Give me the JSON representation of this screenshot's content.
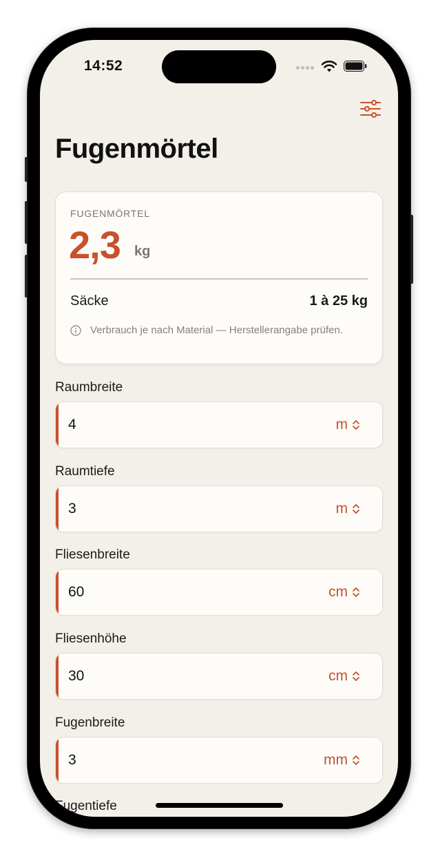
{
  "status_bar": {
    "time": "14:52"
  },
  "page": {
    "title": "Fugenmörtel"
  },
  "result": {
    "label": "FUGENMÖRTEL",
    "value": "2,3",
    "unit": "kg",
    "bags_label": "Säcke",
    "bags_value": "1 à 25 kg",
    "note": "Verbrauch je nach Material — Herstellerangabe prüfen."
  },
  "fields": [
    {
      "label": "Raumbreite",
      "value": "4",
      "unit": "m"
    },
    {
      "label": "Raumtiefe",
      "value": "3",
      "unit": "m"
    },
    {
      "label": "Fliesenbreite",
      "value": "60",
      "unit": "cm"
    },
    {
      "label": "Fliesenhöhe",
      "value": "30",
      "unit": "cm"
    },
    {
      "label": "Fugenbreite",
      "value": "3",
      "unit": "mm"
    },
    {
      "label": "Fugentiefe"
    }
  ],
  "icons": {
    "filter": "sliders-icon",
    "info": "info-circle-icon",
    "unit_picker": "chevron-up-down-icon"
  },
  "colors": {
    "accent": "#c9512b",
    "background": "#f3f0ea",
    "card": "#fdfcf9"
  }
}
